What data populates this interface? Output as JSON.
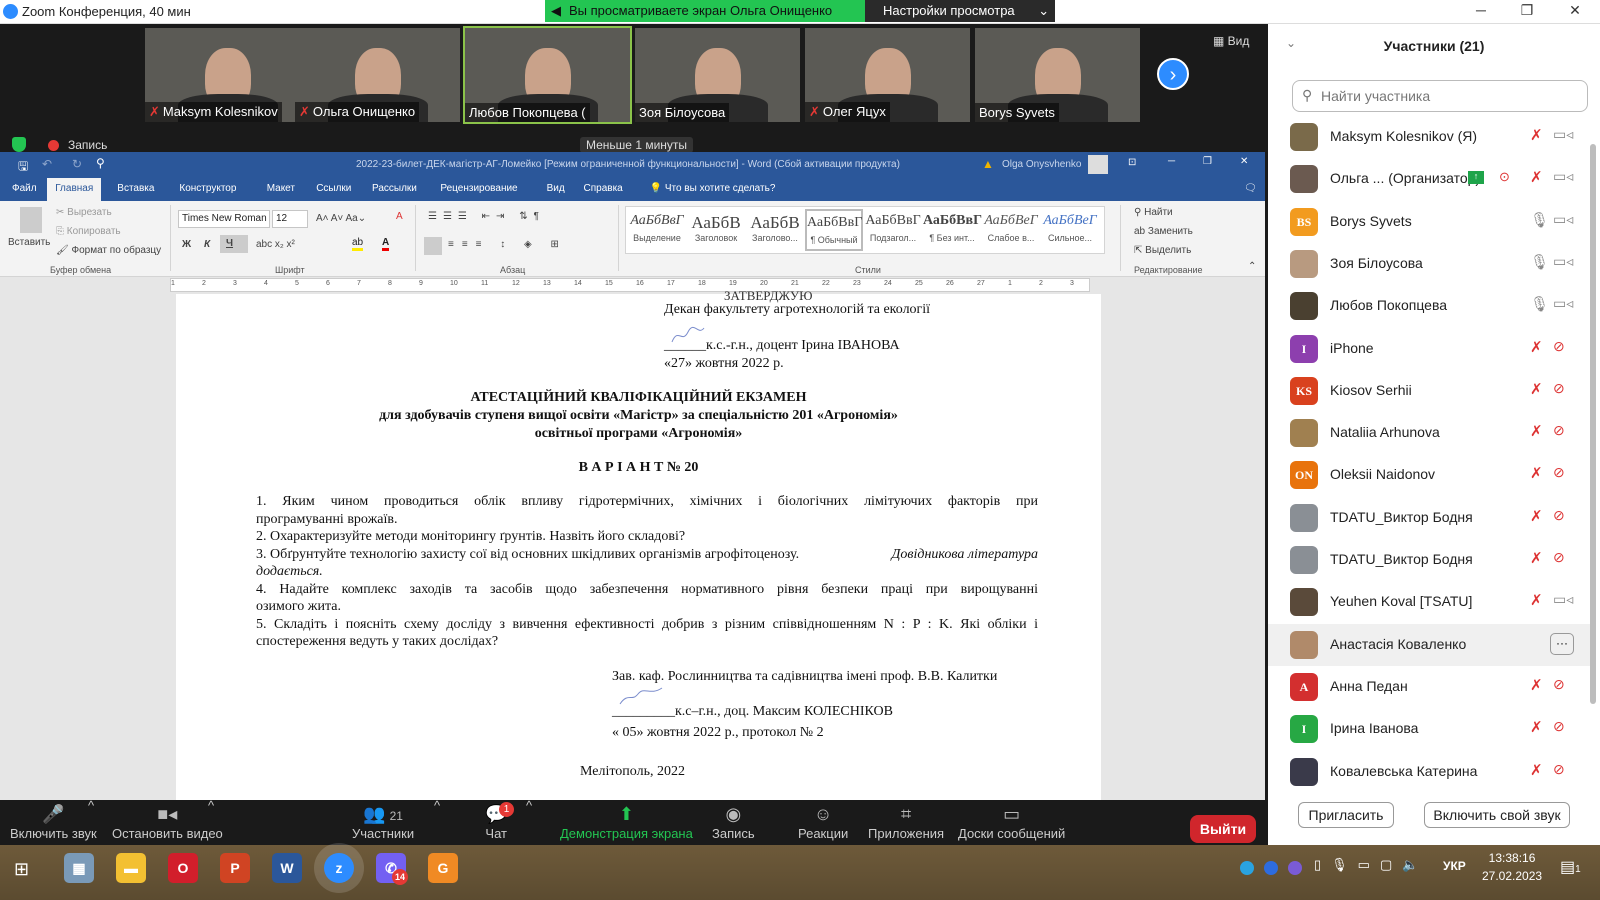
{
  "window": {
    "title": "Zoom Конференция, 40 мин"
  },
  "banner": {
    "viewing": "Вы просматриваете экран Ольга Онищенко",
    "settings": "Настройки просмотра"
  },
  "video_tiles": [
    {
      "name": "Maksym Kolesnikov",
      "muted": true
    },
    {
      "name": "Ольга Онищенко",
      "muted": true
    },
    {
      "name": "Любов Покопцева (",
      "muted": false
    },
    {
      "name": "Зоя Білоусова",
      "muted": false
    },
    {
      "name": "Олег Яцух",
      "muted": true
    },
    {
      "name": "Borys Syvets",
      "muted": false
    }
  ],
  "view_label": "Вид",
  "recording_label": "Запись",
  "timer_tooltip": "Меньше 1 минуты",
  "word": {
    "title": "2022-23-билет-ДЕК-магістр-АГ-Ломейко [Режим ограниченной функциональности]  -  Word (Сбой активации продукта)",
    "user": "Olga Onysvhenko",
    "tabs": [
      "Файл",
      "Главная",
      "Вставка",
      "Конструктор",
      "Макет",
      "Ссылки",
      "Рассылки",
      "Рецензирование",
      "Вид",
      "Справка"
    ],
    "tell_me": "Что вы хотите сделать?",
    "clipboard": {
      "paste": "Вставить",
      "cut": "Вырезать",
      "copy": "Копировать",
      "format_painter": "Формат по образцу",
      "group": "Буфер обмена"
    },
    "font": {
      "name": "Times New Roman",
      "size": "12",
      "group": "Шрифт",
      "bold": "Ж",
      "italic": "К",
      "underline": "Ч"
    },
    "paragraph_group": "Абзац",
    "styles": [
      {
        "preview": "АаБбВвГ",
        "label": "Выделение"
      },
      {
        "preview": "АаБбВ",
        "label": "Заголовок"
      },
      {
        "preview": "АаБбВ",
        "label": "Заголово..."
      },
      {
        "preview": "АаБбВвГ",
        "label": "¶ Обычный"
      },
      {
        "preview": "АаБбВвГ",
        "label": "Подзагол..."
      },
      {
        "preview": "АаБбВвГ",
        "label": "¶ Без инт..."
      },
      {
        "preview": "АаБбВеГ",
        "label": "Слабое в..."
      },
      {
        "preview": "АаБбВеГ",
        "label": "Сильное..."
      }
    ],
    "styles_group": "Стили",
    "editing": {
      "find": "Найти",
      "replace": "Заменить",
      "select": "Выделить",
      "group": "Редактирование"
    }
  },
  "document": {
    "approve": "ЗАТВЕРДЖУЮ",
    "dean": "Декан факультету агротехнологій та екології",
    "dean_sign": "______к.с.-г.н., доцент Ірина ІВАНОВА",
    "dean_date": "«27» жовтня 2022 р.",
    "title1": "АТЕСТАЦІЙНИЙ КВАЛІФІКАЦІЙНИЙ ЕКЗАМЕН",
    "title2": "для здобувачів ступеня вищої освіти «Магістр» за спеціальністю 201 «Агрономія»",
    "title3": "освітньої програми «Агрономія»",
    "variant": "В А Р І А Н Т № 20",
    "q1a": "1. Яким чином проводиться облік впливу гідротермічних, хімічних і біологічних лімітуючих факторів при",
    "q1b": "програмуванні врожаїв.",
    "q2": "2. Охарактеризуйте методи моніторингу ґрунтів. Назвіть його складові?",
    "q3a": "3. Обґрунтуйте технологію захисту сої від основних шкідливих організмів агрофітоценозу.",
    "q3a_it": "Довідникова література",
    "q3b": "додається.",
    "q4a": "4. Надайте комплекс заходів та засобів щодо забезпечення нормативного рівня безпеки праці при вирощуванні",
    "q4b": "озимого жита.",
    "q5a": "5. Складіть і поясніть схему досліду з вивчення ефективності добрив з різним співвідношенням N : P : K. Які обліки і",
    "q5b": "спостереження ведуть у таких дослідах?",
    "head": "Зав. каф. Рослинництва та садівництва імені проф. В.В. Калитки",
    "head_sign": "_________к.с–г.н., доц. Максим КОЛЕСНІКОВ",
    "head_date": "« 05»  жовтня  2022  р., протокол №  2",
    "city": "Мелітополь, 2022"
  },
  "toolbar": {
    "unmute": "Включить звук",
    "stop_video": "Остановить видео",
    "participants": "Участники",
    "participants_count": "21",
    "chat": "Чат",
    "chat_badge": "1",
    "share": "Демонстрация экрана",
    "record": "Запись",
    "reactions": "Реакции",
    "apps": "Приложения",
    "whiteboards": "Доски сообщений",
    "leave": "Выйти"
  },
  "panel": {
    "title": "Участники (21)",
    "search_placeholder": "Найти участника",
    "participants": [
      {
        "name": "Maksym Kolesnikov (Я)",
        "avatar": "",
        "color": "#7a6a4a",
        "mic": "muted",
        "cam": "on"
      },
      {
        "name": "Ольга ... (Организатор)",
        "avatar": "",
        "color": "#6b5a50",
        "mic": "muted",
        "cam": "on",
        "sharing": true
      },
      {
        "name": "Borys Syvets",
        "avatar": "BS",
        "color": "#f29b1f",
        "mic": "on",
        "cam": "on"
      },
      {
        "name": "Зоя Білоусова",
        "avatar": "",
        "color": "#b89a80",
        "mic": "on",
        "cam": "on"
      },
      {
        "name": "Любов Покопцева",
        "avatar": "",
        "color": "#4a4030",
        "mic": "on",
        "cam": "on"
      },
      {
        "name": "iPhone",
        "avatar": "I",
        "color": "#8d3fae",
        "mic": "muted",
        "cam": "off"
      },
      {
        "name": "Kiosov Serhii",
        "avatar": "KS",
        "color": "#d9411e",
        "mic": "muted",
        "cam": "off"
      },
      {
        "name": "Nataliia Arhunova",
        "avatar": "",
        "color": "#a08050",
        "mic": "muted",
        "cam": "off"
      },
      {
        "name": "Oleksii Naidonov",
        "avatar": "ON",
        "color": "#e8730c",
        "mic": "muted",
        "cam": "off"
      },
      {
        "name": "TDATU_Виктор Бодня",
        "avatar": "",
        "color": "#8a8f95",
        "mic": "muted",
        "cam": "off"
      },
      {
        "name": "TDATU_Виктор Бодня",
        "avatar": "",
        "color": "#8a8f95",
        "mic": "muted",
        "cam": "off"
      },
      {
        "name": "Yeuhen Koval [TSATU]",
        "avatar": "",
        "color": "#5a4a3a",
        "mic": "muted",
        "cam": "on"
      },
      {
        "name": "Анастасія Коваленко",
        "avatar": "",
        "color": "#b08a6a",
        "mic": "",
        "cam": "",
        "highlight": true
      },
      {
        "name": "Анна Педан",
        "avatar": "A",
        "color": "#d32f2f",
        "mic": "muted",
        "cam": "off"
      },
      {
        "name": "Ірина Іванова",
        "avatar": "I",
        "color": "#27a844",
        "mic": "muted",
        "cam": "off"
      },
      {
        "name": "Ковалевська Катерина",
        "avatar": "",
        "color": "#3a3a4a",
        "mic": "muted",
        "cam": "off"
      }
    ],
    "invite": "Пригласить",
    "unmute_me": "Включить свой звук"
  },
  "taskbar": {
    "apps": [
      "calculator",
      "explorer",
      "opera",
      "powerpoint",
      "word",
      "zoom",
      "viber",
      "pdf"
    ],
    "viber_badge": "14",
    "lang": "УКР",
    "time": "13:38:16",
    "date": "27.02.2023",
    "notif": "1"
  }
}
